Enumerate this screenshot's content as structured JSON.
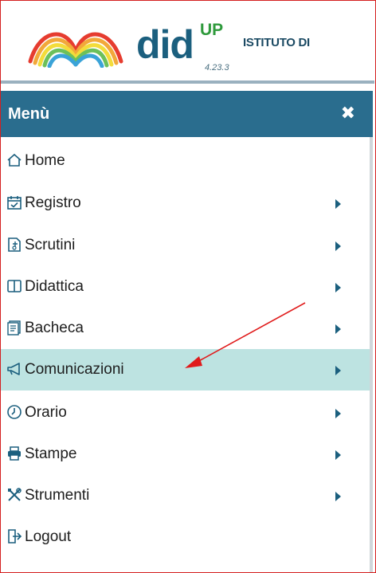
{
  "header": {
    "brand_main": "did",
    "brand_sup": "UP",
    "version": "4.23.3",
    "school_name": "ISTITUTO DI"
  },
  "menu": {
    "title": "Menù",
    "close_icon": "close-icon",
    "items": [
      {
        "label": "Home",
        "icon": "home-icon",
        "submenu": false,
        "active": false
      },
      {
        "label": "Registro",
        "icon": "calendar-check-icon",
        "submenu": true,
        "active": false
      },
      {
        "label": "Scrutini",
        "icon": "report-icon",
        "submenu": true,
        "active": false
      },
      {
        "label": "Didattica",
        "icon": "book-icon",
        "submenu": true,
        "active": false
      },
      {
        "label": "Bacheca",
        "icon": "board-icon",
        "submenu": true,
        "active": false
      },
      {
        "label": "Comunicazioni",
        "icon": "megaphone-icon",
        "submenu": true,
        "active": true
      },
      {
        "label": "Orario",
        "icon": "clock-icon",
        "submenu": true,
        "active": false
      },
      {
        "label": "Stampe",
        "icon": "printer-icon",
        "submenu": true,
        "active": false
      },
      {
        "label": "Strumenti",
        "icon": "tools-icon",
        "submenu": true,
        "active": false
      },
      {
        "label": "Logout",
        "icon": "logout-icon",
        "submenu": false,
        "active": false
      }
    ]
  },
  "colors": {
    "header_bar": "#2a6d8e",
    "active_row": "#bde3e1",
    "annotation_arrow": "#e01b1b",
    "frame_border": "#d42020"
  }
}
